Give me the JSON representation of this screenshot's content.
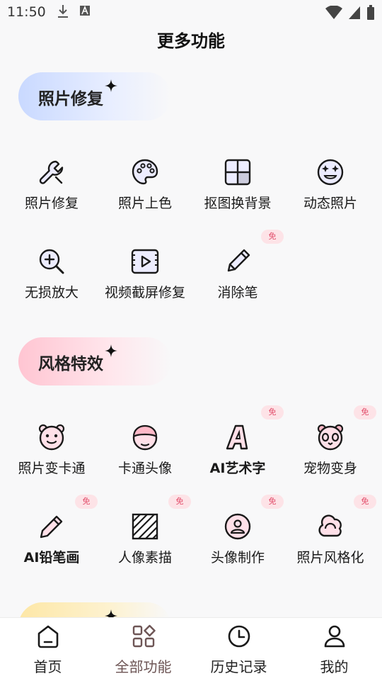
{
  "status_bar": {
    "time": "11:50"
  },
  "page": {
    "title": "更多功能"
  },
  "sections": [
    {
      "title": "照片修复",
      "tools": [
        {
          "label": "照片修复",
          "icon": "wrench-icon"
        },
        {
          "label": "照片上色",
          "icon": "palette-icon"
        },
        {
          "label": "抠图换背景",
          "icon": "grid-icon"
        },
        {
          "label": "动态照片",
          "icon": "star-face-icon"
        },
        {
          "label": "无损放大",
          "icon": "zoom-in-icon"
        },
        {
          "label": "视频截屏修复",
          "icon": "video-frame-icon"
        },
        {
          "label": "消除笔",
          "icon": "pencil-icon",
          "badge": "免"
        }
      ]
    },
    {
      "title": "风格特效",
      "tools": [
        {
          "label": "照片变卡通",
          "icon": "bear-face-icon"
        },
        {
          "label": "卡通头像",
          "icon": "cartoon-head-icon"
        },
        {
          "label": "AI艺术字",
          "icon": "art-letter-a-icon",
          "badge": "免"
        },
        {
          "label": "宠物变身",
          "icon": "panda-icon",
          "badge": "免"
        },
        {
          "label": "AI铅笔画",
          "icon": "pencil-drawing-icon",
          "badge": "免"
        },
        {
          "label": "人像素描",
          "icon": "sketch-hatch-icon",
          "badge": "免"
        },
        {
          "label": "头像制作",
          "icon": "avatar-icon",
          "badge": "免"
        },
        {
          "label": "照片风格化",
          "icon": "cloud-style-icon",
          "badge": "免"
        }
      ]
    }
  ],
  "bottom_nav": {
    "items": [
      {
        "label": "首页",
        "icon": "home-icon",
        "active": false
      },
      {
        "label": "全部功能",
        "icon": "apps-icon",
        "active": true
      },
      {
        "label": "历史记录",
        "icon": "clock-icon",
        "active": false
      },
      {
        "label": "我的",
        "icon": "user-icon",
        "active": false
      }
    ]
  },
  "colors": {
    "accent_active": "#6d5555",
    "badge_bg": "#fde3e7",
    "badge_text": "#e24c6a",
    "section1_gradient": "#c9d9ff",
    "section2_gradient": "#ffc5d2",
    "section3_gradient": "#fde7a6"
  }
}
